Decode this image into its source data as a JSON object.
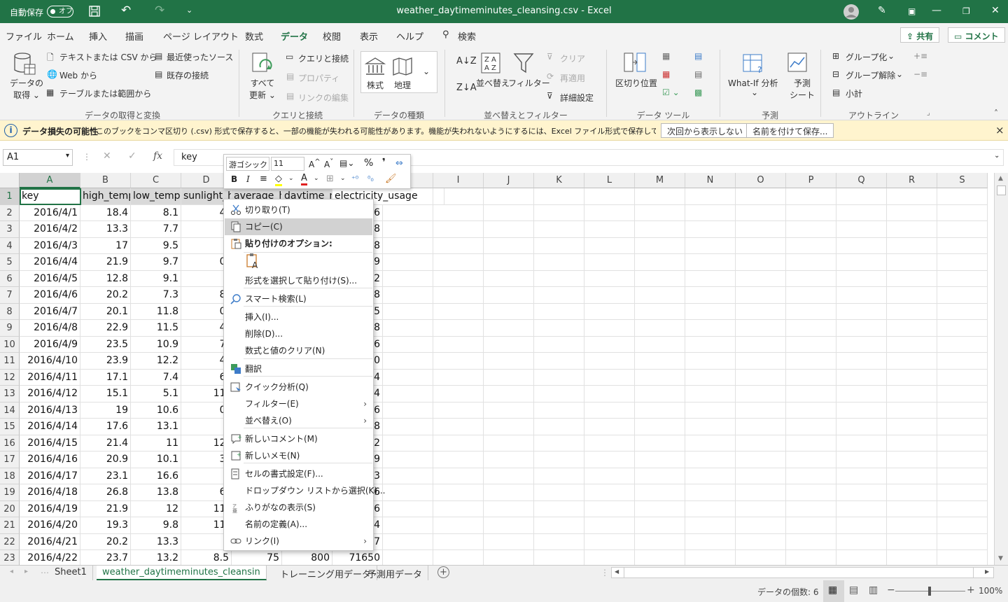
{
  "titlebar": {
    "autosave_label": "自動保存",
    "autosave_state": "オフ",
    "title": "weather_daytimeminutes_cleansing.csv  -  Excel"
  },
  "menubar": {
    "items": [
      "ファイル",
      "ホーム",
      "挿入",
      "描画",
      "ページ レイアウト",
      "数式",
      "データ",
      "校閲",
      "表示",
      "ヘルプ"
    ],
    "active_index": 6,
    "search": "検索",
    "share": "共有",
    "comment": "コメント"
  },
  "ribbon": {
    "get_data": {
      "get_data_btn": [
        "データの",
        "取得 ⌄"
      ],
      "from_csv": "テキストまたは CSV から",
      "from_web": "Web から",
      "from_table": "テーブルまたは範囲から",
      "recent": "最近使ったソース",
      "existing": "既存の接続",
      "group_label": "データの取得と変換"
    },
    "queries": {
      "refresh_all": [
        "すべて",
        "更新 ⌄"
      ],
      "queries_conn": "クエリと接続",
      "properties": "プロパティ",
      "edit_links": "リンクの編集",
      "group_label": "クエリと接続"
    },
    "data_types": {
      "stocks": "株式",
      "geography": "地理",
      "group_label": "データの種類"
    },
    "sort_filter": {
      "sort": "並べ替え",
      "filter": "フィルター",
      "clear": "クリア",
      "reapply": "再適用",
      "advanced": "詳細設定",
      "group_label": "並べ替えとフィルター"
    },
    "data_tools": {
      "text_to_columns": "区切り位置",
      "group_label": "データ ツール"
    },
    "forecast": {
      "whatif": "What-If 分析",
      "forecast_sheet": [
        "予測",
        "シート"
      ],
      "group_label": "予測"
    },
    "outline": {
      "group": "グループ化",
      "ungroup": "グループ解除",
      "subtotal": "小計",
      "group_label": "アウトライン"
    }
  },
  "notice": {
    "title": "データ損失の可能性",
    "message": "このブックをコンマ区切り (.csv) 形式で保存すると、一部の機能が失われる可能性があります。機能が失われないようにするには、Excel ファイル形式で保存してください。",
    "dismiss": "次回から表示しない",
    "save_as": "名前を付けて保存...",
    "info_icon": "i",
    "close_icon": "×"
  },
  "formula_bar": {
    "name_box": "A1",
    "content": "key",
    "fx": "fx"
  },
  "grid": {
    "columns": [
      "A",
      "B",
      "C",
      "D",
      "E",
      "F",
      "G",
      "H",
      "I",
      "J",
      "K",
      "L",
      "M",
      "N",
      "O",
      "P",
      "Q",
      "R",
      "S"
    ],
    "header_row": [
      "key",
      "high_temp",
      "low_temp",
      "sunlight_h",
      "average_h",
      "daytime_m",
      "electricity_usage"
    ],
    "rows": [
      [
        "1",
        "key",
        "high_temp",
        "low_tempe",
        "sunlight_h",
        "average_h",
        "daytime_m",
        "electricity_usage"
      ],
      [
        "2",
        "2016/4/1",
        "18.4",
        "8.1",
        "4.",
        "",
        "",
        "26"
      ],
      [
        "3",
        "2016/4/2",
        "13.3",
        "7.7",
        "",
        "",
        "",
        "78"
      ],
      [
        "4",
        "2016/4/3",
        "17",
        "9.5",
        "",
        "",
        "",
        "98"
      ],
      [
        "5",
        "2016/4/4",
        "21.9",
        "9.7",
        "0.",
        "",
        "",
        "49"
      ],
      [
        "6",
        "2016/4/5",
        "12.8",
        "9.1",
        "",
        "",
        "",
        "72"
      ],
      [
        "7",
        "2016/4/6",
        "20.2",
        "7.3",
        "8.",
        "",
        "",
        "18"
      ],
      [
        "8",
        "2016/4/7",
        "20.1",
        "11.8",
        "0.",
        "",
        "",
        "25"
      ],
      [
        "9",
        "2016/4/8",
        "22.9",
        "11.5",
        "4.",
        "",
        "",
        "08"
      ],
      [
        "10",
        "2016/4/9",
        "23.5",
        "10.9",
        "7.",
        "",
        "",
        "66"
      ],
      [
        "11",
        "2016/4/10",
        "23.9",
        "12.2",
        "4.",
        "",
        "",
        "50"
      ],
      [
        "12",
        "2016/4/11",
        "17.1",
        "7.4",
        "6.",
        "",
        "",
        "74"
      ],
      [
        "13",
        "2016/4/12",
        "15.1",
        "5.1",
        "11.",
        "",
        "",
        "04"
      ],
      [
        "14",
        "2016/4/13",
        "19",
        "10.6",
        "0.",
        "",
        "",
        "26"
      ],
      [
        "15",
        "2016/4/14",
        "17.6",
        "13.1",
        "",
        "",
        "",
        "48"
      ],
      [
        "16",
        "2016/4/15",
        "21.4",
        "11",
        "12.",
        "",
        "",
        "72"
      ],
      [
        "17",
        "2016/4/16",
        "20.9",
        "10.1",
        "3.",
        "",
        "",
        "29"
      ],
      [
        "18",
        "2016/4/17",
        "23.1",
        "16.6",
        "",
        "",
        "",
        "43"
      ],
      [
        "19",
        "2016/4/18",
        "26.8",
        "13.8",
        "6.",
        "",
        "",
        "46"
      ],
      [
        "20",
        "2016/4/19",
        "21.9",
        "12",
        "11.",
        "",
        "",
        "36"
      ],
      [
        "21",
        "2016/4/20",
        "19.3",
        "9.8",
        "11.",
        "",
        "",
        "74"
      ],
      [
        "22",
        "2016/4/21",
        "20.2",
        "13.3",
        "",
        "",
        "",
        "67"
      ],
      [
        "23",
        "2016/4/22",
        "23.7",
        "13.2",
        "8.5",
        "75",
        "800",
        "71650"
      ]
    ]
  },
  "mini_toolbar": {
    "font": "游ゴシック",
    "size": "11",
    "grow": "A^",
    "shrink": "A˅",
    "percent": "%",
    "comma": "❜",
    "bold": "B",
    "italic": "I"
  },
  "context_menu": {
    "items": [
      {
        "label": "切り取り(T)",
        "icon": "scissors-icon"
      },
      {
        "label": "コピー(C)",
        "icon": "copy-icon",
        "highlight": true
      },
      {
        "label": "貼り付けのオプション:",
        "icon": "paste-icon",
        "bold": true
      },
      {
        "label": "形式を選択して貼り付け(S)..."
      },
      {
        "label": "スマート検索(L)",
        "icon": "smart-lookup-icon"
      },
      {
        "label": "挿入(I)..."
      },
      {
        "label": "削除(D)..."
      },
      {
        "label": "数式と値のクリア(N)"
      },
      {
        "label": "翻訳",
        "icon": "translate-icon"
      },
      {
        "label": "クイック分析(Q)",
        "icon": "quick-analysis-icon"
      },
      {
        "label": "フィルター(E)",
        "submenu": true
      },
      {
        "label": "並べ替え(O)",
        "submenu": true
      },
      {
        "label": "新しいコメント(M)",
        "icon": "comment-icon"
      },
      {
        "label": "新しいメモ(N)",
        "icon": "note-icon"
      },
      {
        "label": "セルの書式設定(F)...",
        "icon": "format-cells-icon"
      },
      {
        "label": "ドロップダウン リストから選択(K)..."
      },
      {
        "label": "ふりがなの表示(S)",
        "icon": "furigana-icon"
      },
      {
        "label": "名前の定義(A)..."
      },
      {
        "label": "リンク(I)",
        "icon": "link-icon",
        "submenu": true
      }
    ]
  },
  "sheet_tabs": {
    "tabs": [
      "Sheet1",
      "weather_daytimeminutes_cleansin",
      "トレーニング用データ",
      "予測用データ"
    ],
    "active_index": 1
  },
  "status": {
    "count": "データの個数: 6",
    "zoom": "100%"
  },
  "colors": {
    "excel_green": "#217346",
    "notice_bg": "#fff4ce"
  }
}
